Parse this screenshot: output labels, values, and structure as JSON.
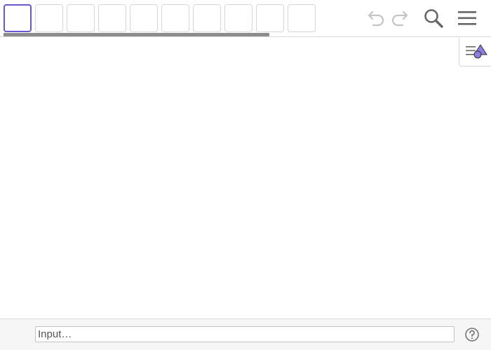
{
  "toolbar": {
    "tool_count": 10,
    "selected_tool_index": 0
  },
  "input": {
    "placeholder": "Input…"
  },
  "icons": {
    "undo": "undo-icon",
    "redo": "redo-icon",
    "search": "search-icon",
    "menu": "menu-icon",
    "style_bar": "style-bar-toggle-icon",
    "help": "help-icon"
  },
  "colors": {
    "selected_tool_border": "#6557d2",
    "style_bar_shape": "#8a7fe0"
  }
}
